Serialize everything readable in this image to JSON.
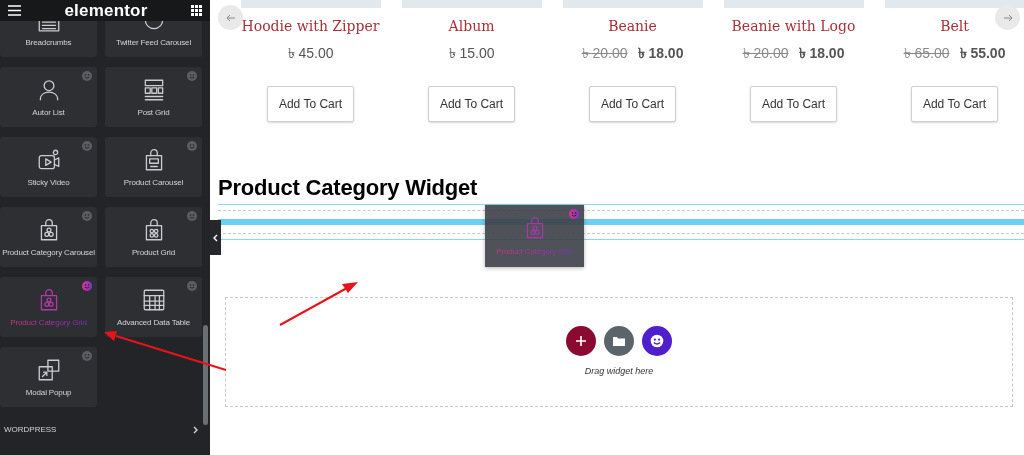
{
  "panel": {
    "title": "elementor",
    "widgets": [
      {
        "label": "Breadcrumbs",
        "kind": "breadcrumbs",
        "badge": false,
        "selected": false
      },
      {
        "label": "Twitter Feed Carousel",
        "kind": "twitter",
        "badge": false,
        "selected": false
      },
      {
        "label": "Autor List",
        "kind": "person",
        "badge": true,
        "selected": false
      },
      {
        "label": "Post Grid",
        "kind": "postgrid",
        "badge": true,
        "selected": false
      },
      {
        "label": "Sticky Video",
        "kind": "video",
        "badge": true,
        "selected": false
      },
      {
        "label": "Product Carousel",
        "kind": "bag",
        "badge": true,
        "selected": false
      },
      {
        "label": "Product Category Carousel",
        "kind": "bagcat",
        "badge": true,
        "selected": false
      },
      {
        "label": "Product Grid",
        "kind": "baggrid",
        "badge": true,
        "selected": false
      },
      {
        "label": "Product Category Grid",
        "kind": "bagcat",
        "badge": true,
        "selected": true
      },
      {
        "label": "Advanced Data Table",
        "kind": "table",
        "badge": true,
        "selected": false
      },
      {
        "label": "Modal Popup",
        "kind": "popup",
        "badge": true,
        "selected": false
      }
    ],
    "section": "WORDPRESS"
  },
  "products": [
    {
      "title": "Hoodie with Zipper",
      "price": "৳ 45.00",
      "button": "Add To Cart"
    },
    {
      "title": "Album",
      "price": "৳ 15.00",
      "button": "Add To Cart"
    },
    {
      "title": "Beanie",
      "old_price": "৳ 20.00",
      "price": "৳ 18.00",
      "button": "Add To Cart"
    },
    {
      "title": "Beanie with Logo",
      "old_price": "৳ 20.00",
      "price": "৳ 18.00",
      "button": "Add To Cart"
    },
    {
      "title": "Belt",
      "old_price": "৳ 65.00",
      "price": "৳ 55.00",
      "button": "Add To Cart"
    }
  ],
  "heading": "Product Category Widget",
  "drag_ghost": {
    "label": "Product Category Grid",
    "kind": "bagcat"
  },
  "drop_zone": {
    "hint": "Drag widget here"
  }
}
